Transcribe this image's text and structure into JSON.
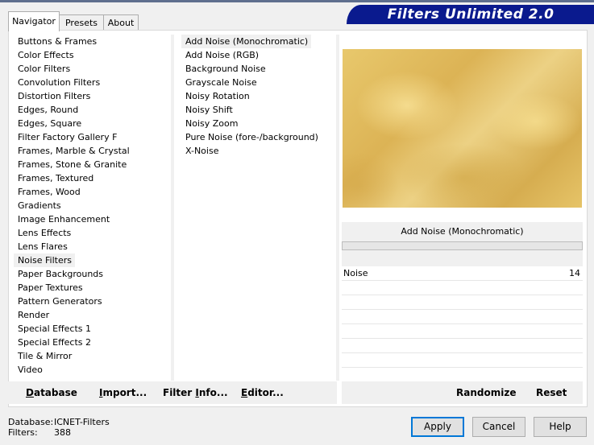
{
  "brand": "Filters Unlimited 2.0",
  "tabs": [
    "Navigator",
    "Presets",
    "About"
  ],
  "categories": [
    "Buttons & Frames",
    "Color Effects",
    "Color Filters",
    "Convolution Filters",
    "Distortion Filters",
    "Edges, Round",
    "Edges, Square",
    "Filter Factory Gallery F",
    "Frames, Marble & Crystal",
    "Frames, Stone & Granite",
    "Frames, Textured",
    "Frames, Wood",
    "Gradients",
    "Image Enhancement",
    "Lens Effects",
    "Lens Flares",
    "Noise Filters",
    "Paper Backgrounds",
    "Paper Textures",
    "Pattern Generators",
    "Render",
    "Special Effects 1",
    "Special Effects 2",
    "Tile & Mirror",
    "Video"
  ],
  "selected_category_index": 16,
  "filters": [
    "Add Noise (Monochromatic)",
    "Add Noise (RGB)",
    "Background Noise",
    "Grayscale Noise",
    "Noisy Rotation",
    "Noisy Shift",
    "Noisy Zoom",
    "Pure Noise (fore-/background)",
    "X-Noise"
  ],
  "selected_filter_index": 0,
  "selected_filter_name": "Add Noise (Monochromatic)",
  "parameters": [
    {
      "name": "Noise",
      "value": "14"
    }
  ],
  "empty_param_rows": 7,
  "progress_fraction": 0,
  "buttons": {
    "database": "Database",
    "import": "Import...",
    "filter_info": "Filter Info...",
    "editor": "Editor...",
    "randomize": "Randomize",
    "reset": "Reset",
    "apply": "Apply",
    "cancel": "Cancel",
    "help": "Help"
  },
  "status": {
    "database_label": "Database:",
    "database_value": "ICNET-Filters",
    "filters_label": "Filters:",
    "filters_value": "388"
  },
  "colors": {
    "brand_bg": "#0a1a8e",
    "default_button_border": "#0078d7",
    "preview_gold": "#e3c064"
  }
}
